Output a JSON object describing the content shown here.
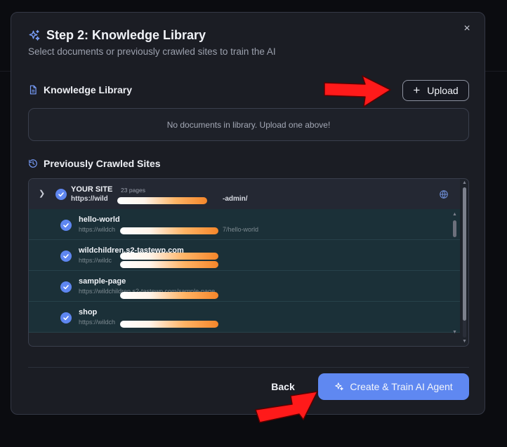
{
  "modal": {
    "title": "Step 2: Knowledge Library",
    "subtitle": "Select documents or previously crawled sites to train the AI",
    "close_label": "×"
  },
  "knowledge_library": {
    "heading": "Knowledge Library",
    "upload_label": "Upload",
    "empty_message": "No documents in library. Upload one above!"
  },
  "crawled_sites": {
    "heading": "Previously Crawled Sites",
    "root": {
      "name": "YOUR SITE",
      "count": "23 pages",
      "url_prefix": "https://wild",
      "url_suffix": "-admin/"
    },
    "children": [
      {
        "name": "hello-world",
        "url_prefix": "https://wildch",
        "url_suffix": "7/hello-world"
      },
      {
        "name": "wildchildren.s2-tastewp.com",
        "url_prefix": "https://wildc",
        "url_suffix": ""
      },
      {
        "name": "sample-page",
        "url_prefix": "https://wildchildren.s2-tastewp.com/sample-page",
        "url_suffix": ""
      },
      {
        "name": "shop",
        "url_prefix": "https://wildch",
        "url_suffix": ""
      }
    ]
  },
  "footer": {
    "back_label": "Back",
    "primary_label": "Create & Train AI Agent"
  },
  "colors": {
    "accent": "#5f88f1",
    "modal_bg": "#1b1d24",
    "child_row_bg": "#1b3038",
    "annotation_arrow": "#ff1a1a"
  },
  "icons": [
    "sparkles-icon",
    "close-icon",
    "document-icon",
    "plus-icon",
    "history-icon",
    "chevron-down-icon",
    "check-circle-icon",
    "globe-icon"
  ]
}
